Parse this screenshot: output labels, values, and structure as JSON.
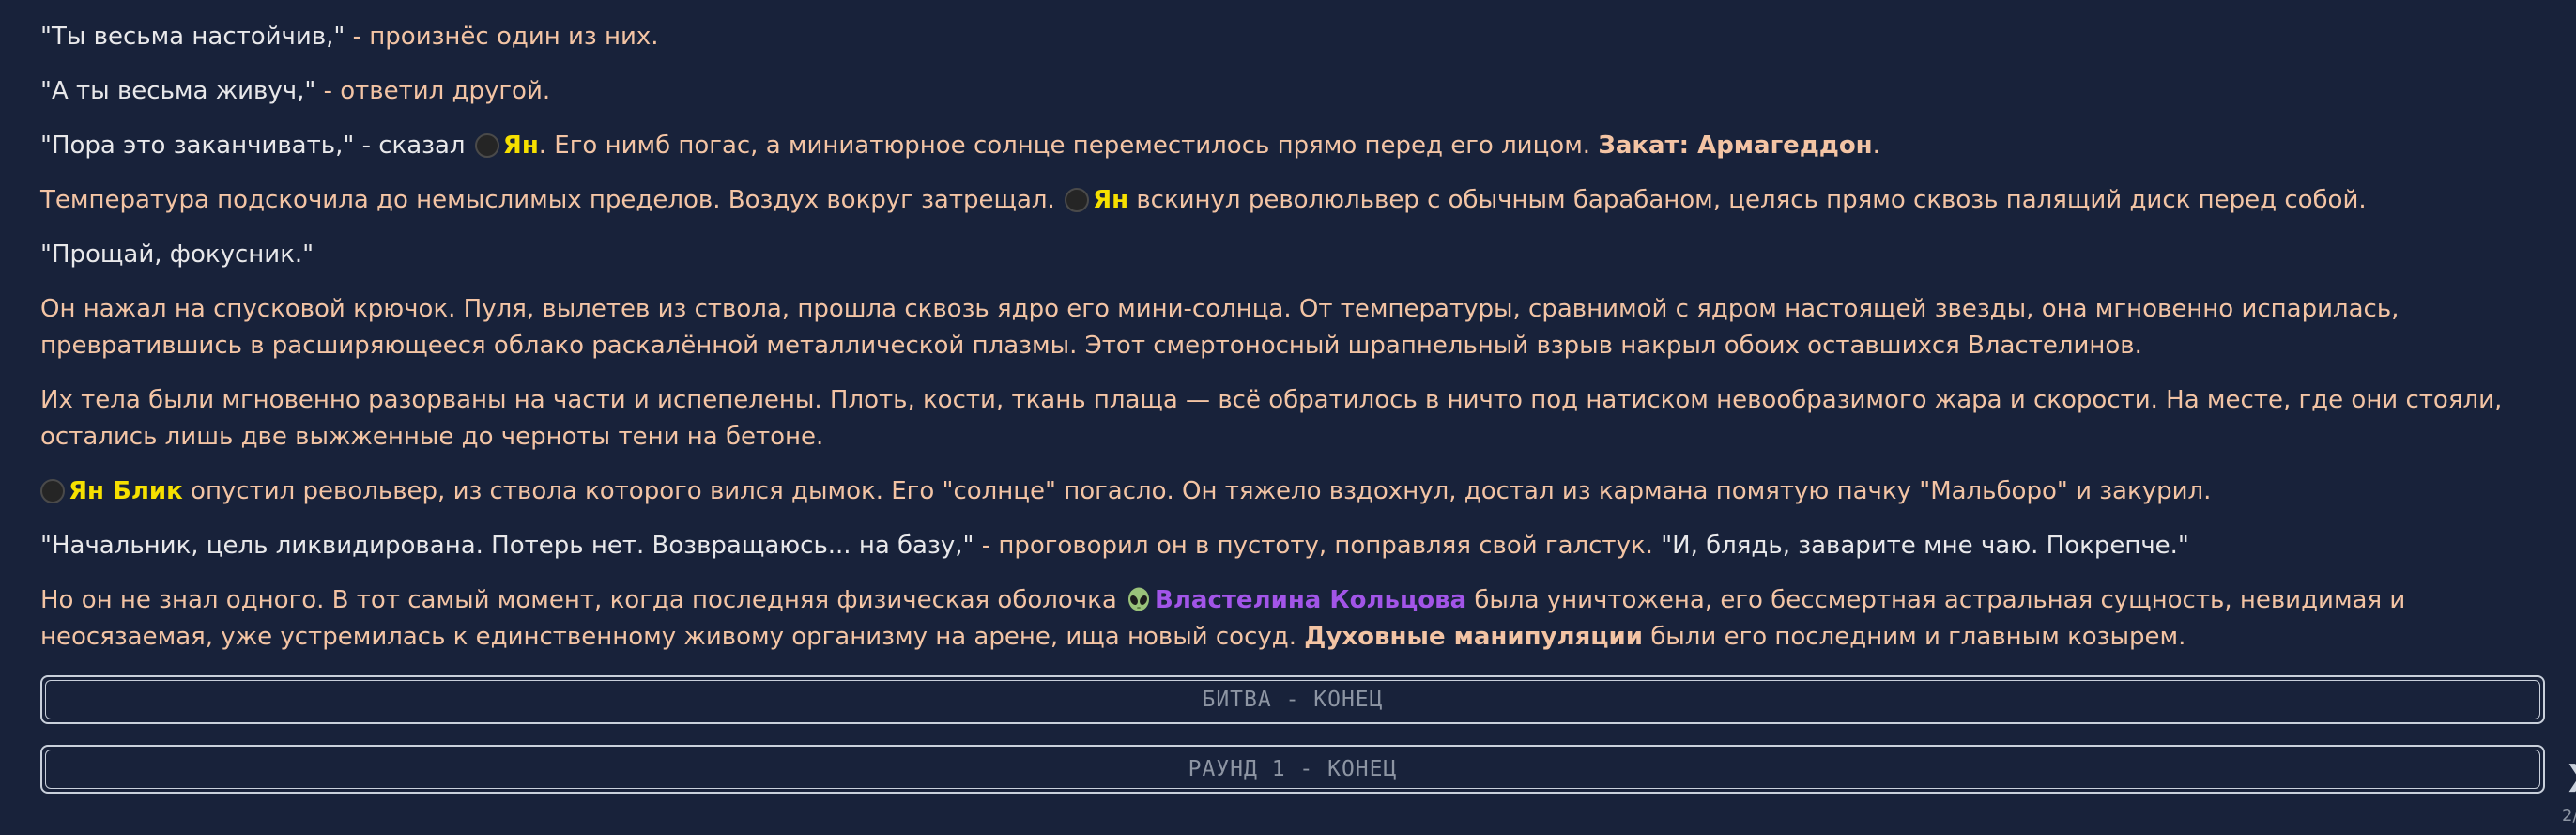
{
  "paragraphs": {
    "p1": {
      "speech": "\"Ты весьма настойчив,\"",
      "narr": " - произнёс один из них."
    },
    "p2": {
      "speech": "\"А ты весьма живуч,\"",
      "narr": " - ответил другой."
    },
    "p3": {
      "speech": "\"Пора это заканчивать,\" - сказал ",
      "name": "Ян",
      "narr": ". Его нимб погас, а миниатюрное солнце переместилось прямо перед его лицом. ",
      "skill": "Закат: Армагеддон",
      "end": "."
    },
    "p4": {
      "narr1": "Температура подскочила до немыслимых пределов. Воздух вокруг затрещал. ",
      "name": "Ян",
      "narr2": " вскинул революльвер с обычным барабаном, целясь прямо сквозь палящий диск перед собой."
    },
    "p5": {
      "speech": "\"Прощай, фокусник.\""
    },
    "p6": {
      "narr": "Он нажал на спусковой крючок. Пуля, вылетев из ствола, прошла сквозь ядро его мини-солнца. От температуры, сравнимой с ядром настоящей звезды, она мгновенно испарилась, превратившись в расширяющееся облако раскалённой металлической плазмы. Этот смертоносный шрапнельный взрыв накрыл обоих оставшихся Властелинов."
    },
    "p7": {
      "narr": "Их тела были мгновенно разорваны на части и испепелены. Плоть, кости, ткань плаща — всё обратилось в ничто под натиском невообразимого жара и скорости. На месте, где они стояли, остались лишь две выжженные до черноты тени на бетоне."
    },
    "p8": {
      "name": "Ян Блик",
      "narr": " опустил револьвер, из ствола которого вился дымок. Его \"солнце\" погасло. Он тяжело вздохнул, достал из кармана помятую пачку \"Мальборо\" и закурил."
    },
    "p9": {
      "speech1": "\"Начальник, цель ликвидирована. Потерь нет. Возвращаюсь... на базу,\"",
      "narr": " - проговорил он в пустоту, поправляя свой галстук. ",
      "speech2": "\"И, блядь, заварите мне чаю. Покрепче.\""
    },
    "p10": {
      "narr1": "Но он не знал одного. В тот самый момент, когда последняя физическая оболочка ",
      "name": "Властелина Кольцова",
      "narr2": " была уничтожена, его бессмертная астральная сущность, невидимая и неосязаемая, уже устремилась к единственному живому организму на арене, ища новый сосуд. ",
      "skill": "Духовные манипуляции",
      "narr3": " были его последним и главным козырем."
    }
  },
  "banners": {
    "battle_end": "БИТВА - КОНЕЦ",
    "round_end": "РАУНД 1 - КОНЕЦ"
  },
  "edge": {
    "chevron": "❯",
    "counter": "2/"
  },
  "icons": {
    "avatar_dot": "dark-circle-avatar-icon",
    "alien": "alien-icon"
  },
  "colors": {
    "background": "#18223a",
    "narration": "#f3c4a4",
    "speech": "#e8e8ea",
    "name_yellow": "#f6e000",
    "name_purple": "#a255e8",
    "banner_border": "#c9d0db",
    "banner_text": "#8d95a3"
  }
}
